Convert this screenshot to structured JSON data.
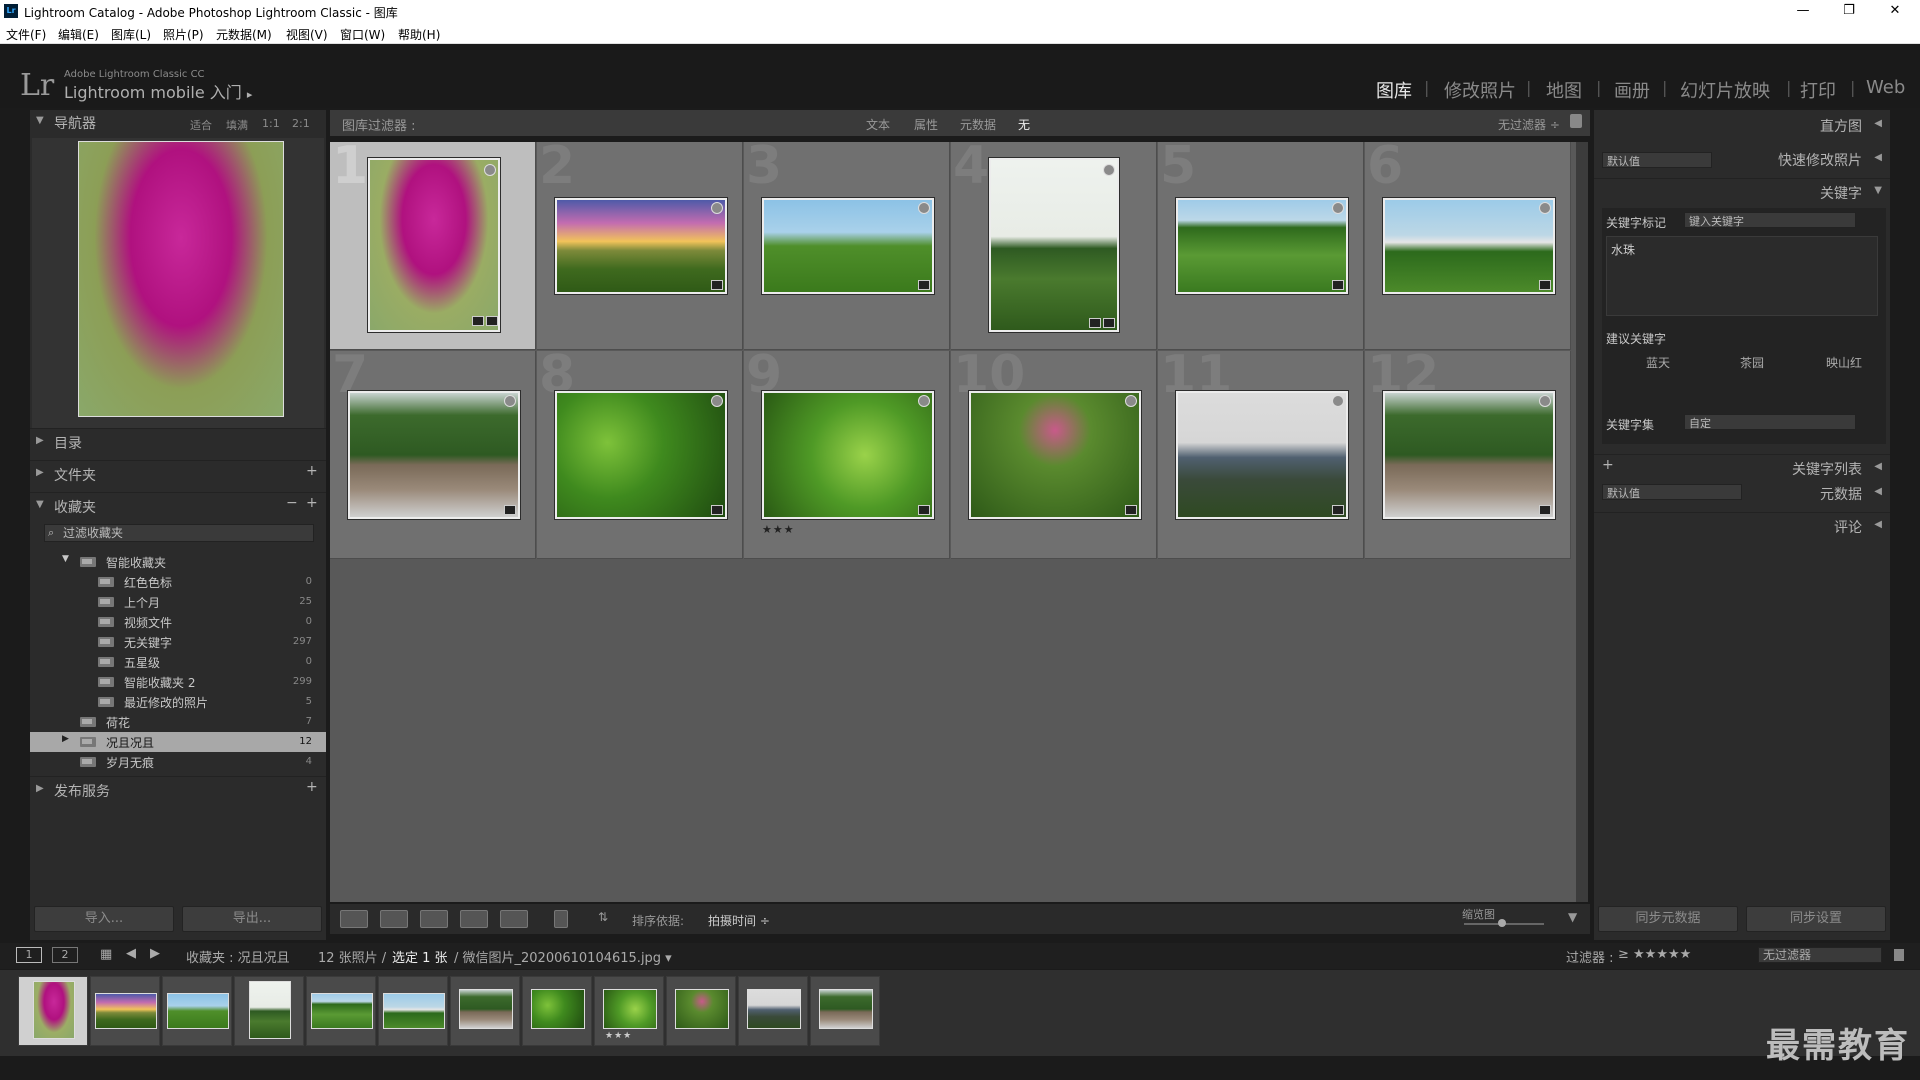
{
  "window": {
    "title": "Lightroom Catalog - Adobe Photoshop Lightroom Classic - 图库",
    "icon": "Lr",
    "minimize": "—",
    "maximize": "❐",
    "close": "✕"
  },
  "menu": [
    "文件(F)",
    "编辑(E)",
    "图库(L)",
    "照片(P)",
    "元数据(M)",
    "视图(V)",
    "窗口(W)",
    "帮助(H)"
  ],
  "identity": {
    "logo": "Lr",
    "line1": "Adobe Lightroom Classic CC",
    "line2": "Lightroom mobile 入门",
    "arrow": "▸"
  },
  "modules": [
    "图库",
    "修改照片",
    "地图",
    "画册",
    "幻灯片放映",
    "打印",
    "Web"
  ],
  "left_panel": {
    "navigator": {
      "title": "导航器",
      "opts": [
        "适合",
        "填满",
        "1:1",
        "2:1"
      ]
    },
    "catalog": "目录",
    "folders": "文件夹",
    "collections": "收藏夹",
    "filter_placeholder": "过滤收藏夹",
    "smart_group": "智能收藏夹",
    "smart_items": [
      {
        "label": "红色色标",
        "count": "0"
      },
      {
        "label": "上个月",
        "count": "25"
      },
      {
        "label": "视频文件",
        "count": "0"
      },
      {
        "label": "无关键字",
        "count": "297"
      },
      {
        "label": "五星级",
        "count": "0"
      },
      {
        "label": "智能收藏夹 2",
        "count": "299"
      },
      {
        "label": "最近修改的照片",
        "count": "5"
      }
    ],
    "other_collections": [
      {
        "label": "荷花",
        "count": "7"
      },
      {
        "label": "况且况且",
        "count": "12"
      },
      {
        "label": "岁月无痕",
        "count": "4"
      }
    ],
    "publish": "发布服务",
    "import_btn": "导入...",
    "export_btn": "导出..."
  },
  "filter_bar": {
    "label": "图库过滤器 :",
    "tabs": [
      "文本",
      "属性",
      "元数据",
      "无"
    ],
    "no_filter": "无过滤器 ÷"
  },
  "grid": {
    "cells": [
      {
        "num": "1",
        "img": "img-flower",
        "stars": ""
      },
      {
        "num": "2",
        "img": "img-sunset",
        "stars": ""
      },
      {
        "num": "3",
        "img": "img-field",
        "stars": ""
      },
      {
        "num": "4",
        "img": "img-tree",
        "stars": ""
      },
      {
        "num": "5",
        "img": "img-hill",
        "stars": ""
      },
      {
        "num": "6",
        "img": "img-house",
        "stars": ""
      },
      {
        "num": "7",
        "img": "img-wall",
        "stars": ""
      },
      {
        "num": "8",
        "img": "img-leaves",
        "stars": ""
      },
      {
        "num": "9",
        "img": "img-bush",
        "stars": "★★★"
      },
      {
        "num": "10",
        "img": "img-pinkbush",
        "stars": ""
      },
      {
        "num": "11",
        "img": "img-building",
        "stars": ""
      },
      {
        "num": "12",
        "img": "img-wall",
        "stars": ""
      }
    ]
  },
  "toolbar": {
    "sort_label": "排序依据:",
    "sort_value": "拍摄时间 ÷",
    "thumb_label": "缩览图"
  },
  "right_panel": {
    "histogram": "直方图",
    "preset_default": "默认值",
    "quick_develop": "快速修改照片",
    "keywords": "关键字",
    "kw_tag_label": "关键字标记",
    "kw_tag_value": "键入关键字",
    "kw_text": "水珠",
    "suggested": "建议关键字",
    "suggestions": [
      "蓝天",
      "茶园",
      "映山红"
    ],
    "kw_set_label": "关键字集",
    "kw_set_value": "自定",
    "kw_list": "关键字列表",
    "metadata_preset": "默认值",
    "metadata": "元数据",
    "comments": "评论",
    "sync_meta": "同步元数据",
    "sync_settings": "同步设置"
  },
  "filmstrip": {
    "page1": "1",
    "page2": "2",
    "breadcrumb": "收藏夹 : 况且况且",
    "photos": "12 张照片 /",
    "selected": "选定 1 张",
    "filename": "/ 微信图片_20200610104615.jpg ▾",
    "filter_label": "过滤器 :",
    "filter_stars": "≥ ★★★★★",
    "filter_value": "无过滤器"
  },
  "watermark": "最需教育"
}
